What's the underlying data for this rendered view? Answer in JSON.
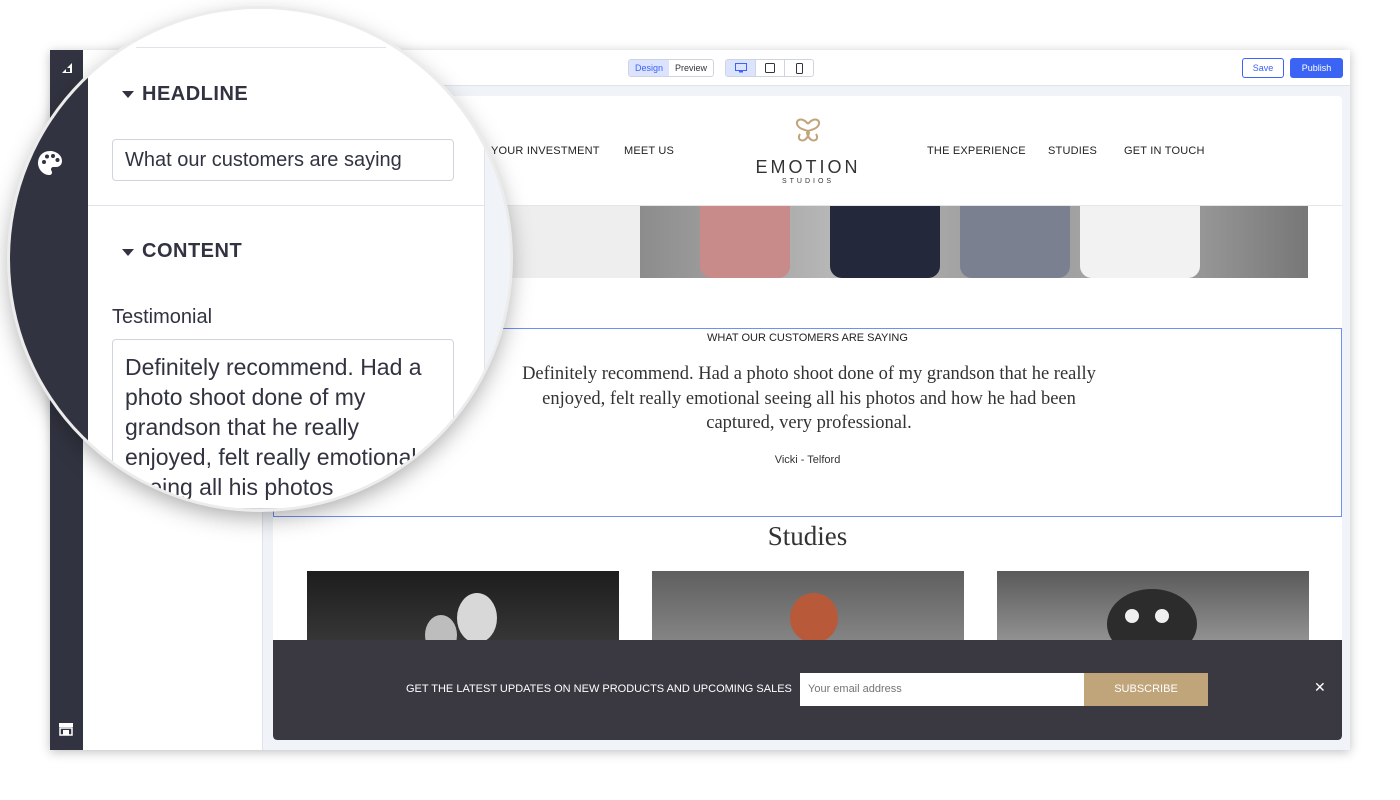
{
  "toolbar": {
    "design_label": "Design",
    "preview_label": "Preview",
    "save_label": "Save",
    "publish_label": "Publish",
    "devices": [
      "desktop-icon",
      "tablet-icon",
      "mobile-icon"
    ]
  },
  "site": {
    "nav_left": [
      "YOUR INVESTMENT",
      "MEET US"
    ],
    "nav_right": [
      "THE EXPERIENCE",
      "STUDIES",
      "GET IN TOUCH"
    ],
    "logo_title": "EMOTION",
    "logo_sub": "STUDIOS"
  },
  "testimonial": {
    "heading": "WHAT OUR CUSTOMERS ARE SAYING",
    "quote": "Definitely recommend. Had a photo shoot done of my grandson that he really enjoyed, felt really emotional seeing all his photos and how he had been captured, very professional.",
    "author": "Vicki - Telford"
  },
  "studies": {
    "title": "Studies"
  },
  "newsletter": {
    "message": "GET THE LATEST UPDATES ON NEW PRODUCTS AND UPCOMING SALES",
    "email_placeholder": "Your email address",
    "subscribe_label": "SUBSCRIBE"
  },
  "panel": {
    "headline_section": "HEADLINE",
    "headline_value": "What our customers are saying",
    "content_section": "CONTENT",
    "testimonial_label": "Testimonial",
    "testimonial_value": "Definitely recommend. Had a photo shoot done of my grandson that he really enjoyed,  felt really emotional seeing all his photos"
  },
  "colors": {
    "accent": "#3c64f4",
    "sidebar_dark": "#313440",
    "subscribe_gold": "#c0a47a",
    "newsletter_bg": "#3a3942"
  }
}
